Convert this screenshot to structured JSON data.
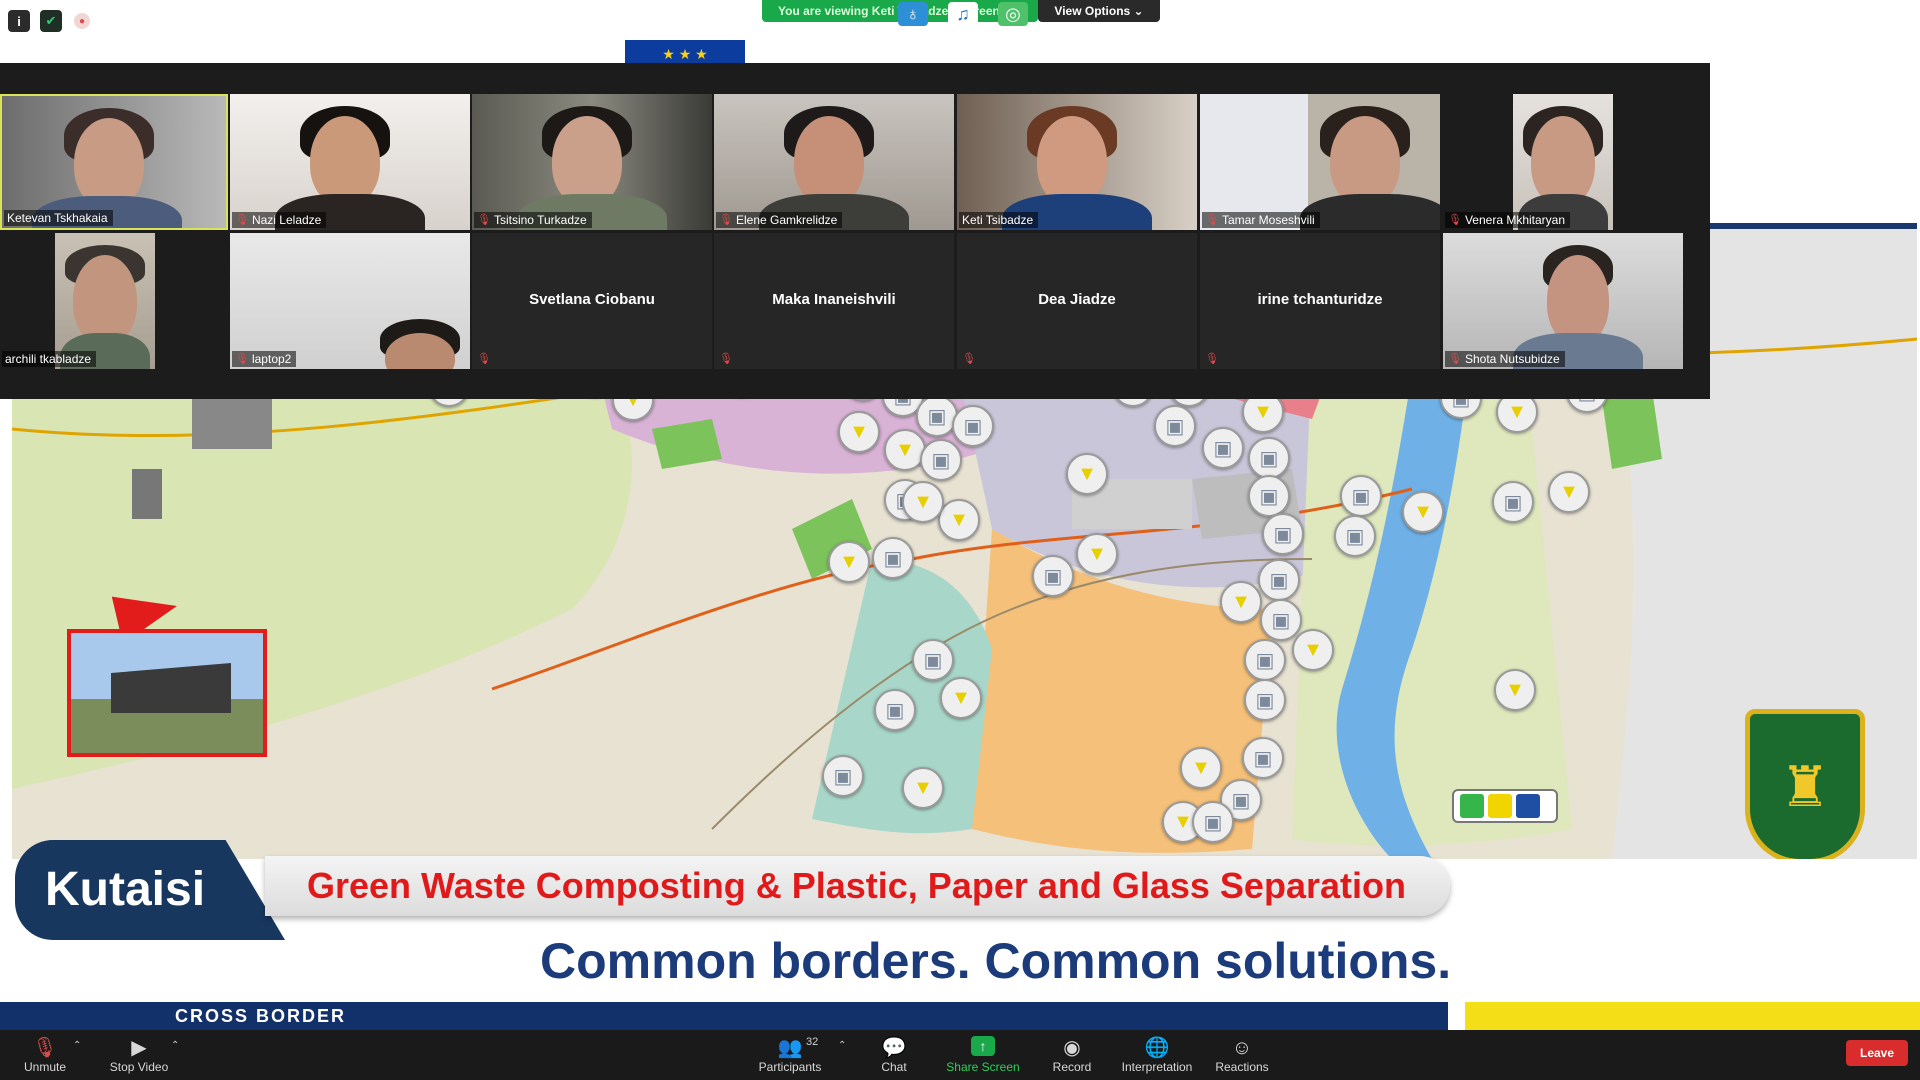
{
  "topbar": {
    "viewing_text": "You are viewing Keti Tsibadze's screen",
    "view_options_label": "View Options ⌄"
  },
  "slide": {
    "city": "Kutaisi",
    "theme": "Green Waste Composting & Plastic, Paper and Glass Separation",
    "tagline": "Common borders. Common solutions.",
    "footer_text": "CROSS BORDER"
  },
  "gallery": {
    "participants": [
      {
        "name": "Ketevan Tskhakaia",
        "video": true,
        "muted": false,
        "active": true
      },
      {
        "name": "Nazi Leladze",
        "video": true,
        "muted": true
      },
      {
        "name": "Tsitsino Turkadze",
        "video": true,
        "muted": true
      },
      {
        "name": "Elene Gamkrelidze",
        "video": true,
        "muted": true
      },
      {
        "name": "Keti Tsibadze",
        "video": true,
        "muted": false
      },
      {
        "name": "Tamar Moseshvili",
        "video": true,
        "muted": true
      },
      {
        "name": "Venera Mkhitaryan",
        "video": true,
        "muted": true
      },
      {
        "name": "archili tkabladze",
        "video": true,
        "muted": false
      },
      {
        "name": "laptop2",
        "video": true,
        "muted": true
      },
      {
        "name": "Svetlana Ciobanu",
        "video": false,
        "muted": true
      },
      {
        "name": "Maka Inaneishvili",
        "video": false,
        "muted": true
      },
      {
        "name": "Dea Jiadze",
        "video": false,
        "muted": true
      },
      {
        "name": "irine tchanturidze",
        "video": false,
        "muted": true
      },
      {
        "name": "Shota Nutsubidze",
        "video": true,
        "muted": true
      }
    ]
  },
  "toolbar": {
    "unmute": "Unmute",
    "stop_video": "Stop Video",
    "participants": "Participants",
    "participants_count": "32",
    "chat": "Chat",
    "share_screen": "Share Screen",
    "record": "Record",
    "interpretation": "Interpretation",
    "reactions": "Reactions",
    "leave": "Leave"
  },
  "colors": {
    "zoom_green": "#19a84a",
    "leave_red": "#d92c2c",
    "slide_title_red": "#e01a1a",
    "slide_navy": "#17375e"
  }
}
